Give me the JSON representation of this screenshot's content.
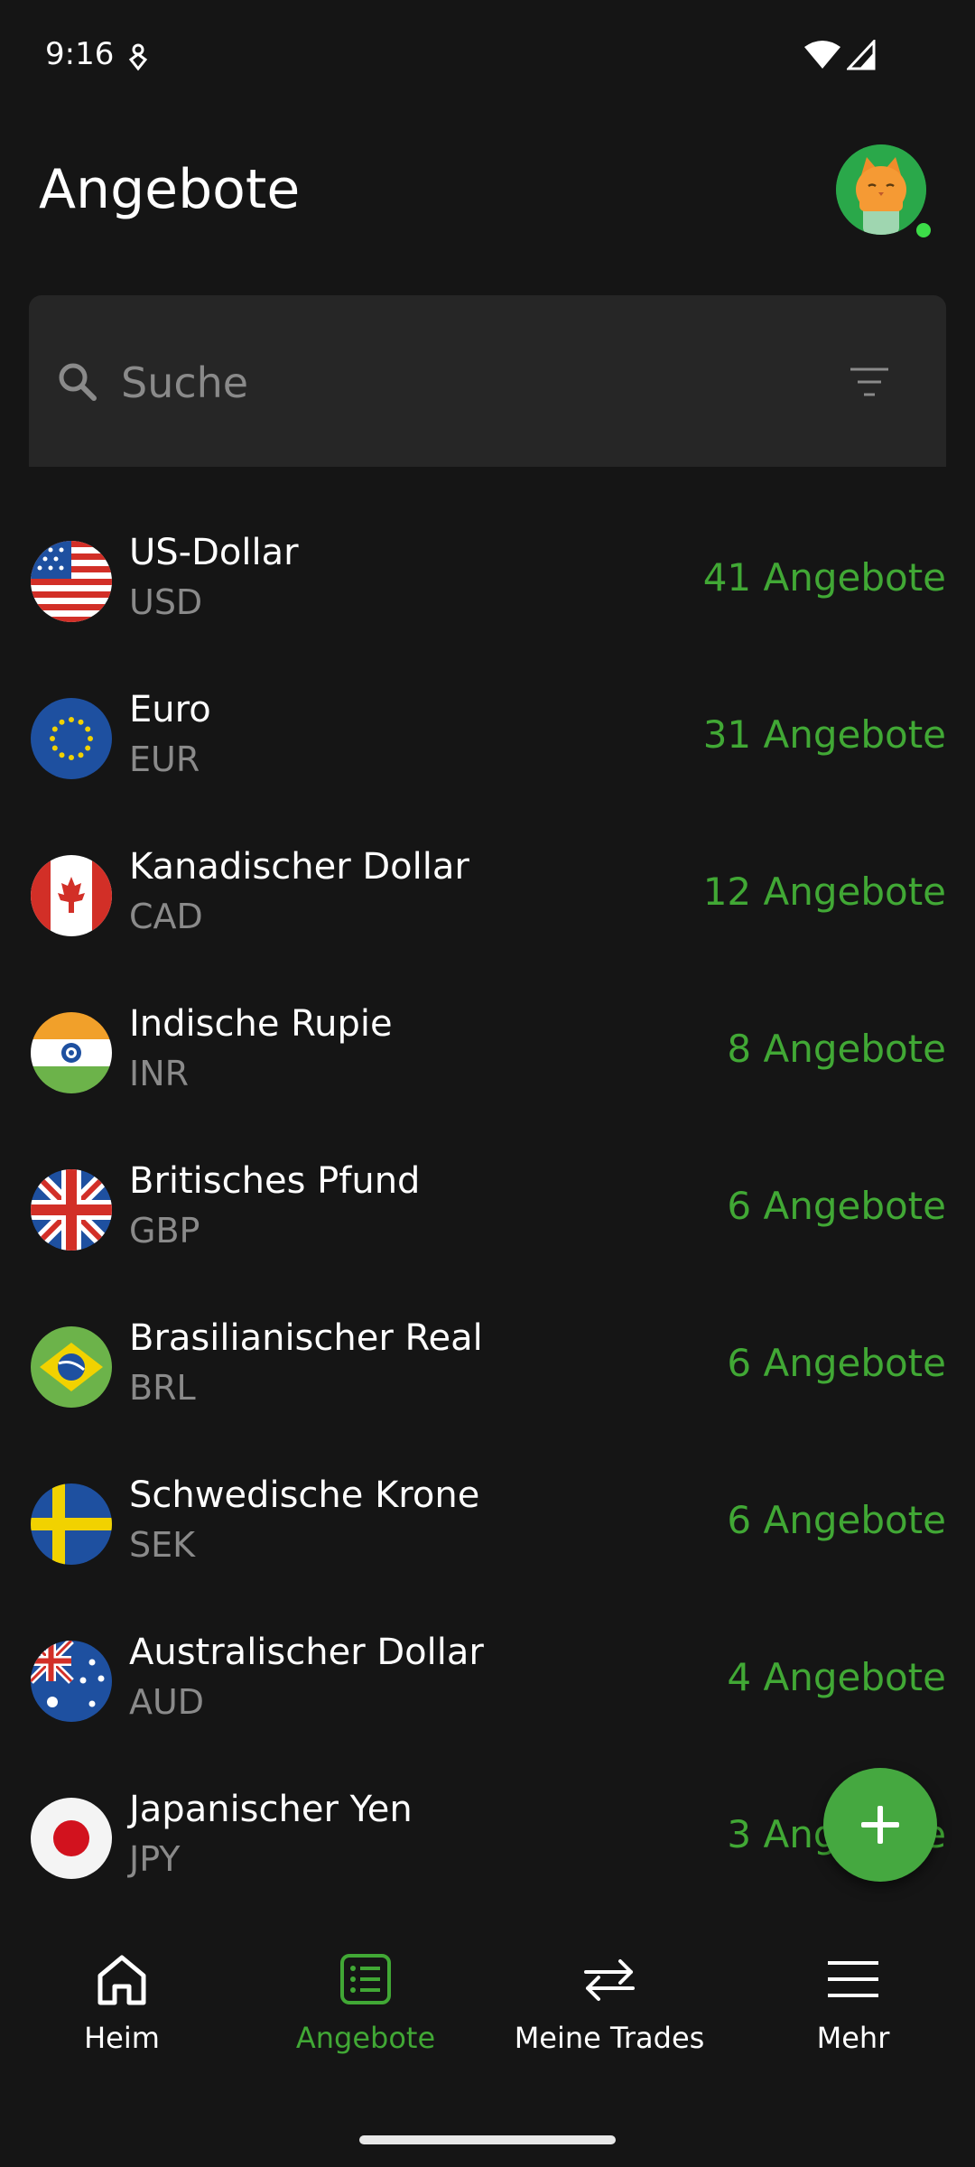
{
  "status_bar": {
    "time": "9:16"
  },
  "header": {
    "title": "Angebote"
  },
  "search": {
    "placeholder": "Suche"
  },
  "currencies": [
    {
      "name": "US-Dollar",
      "code": "USD",
      "offers": "41 Angebote",
      "flag": "us-flag-icon"
    },
    {
      "name": "Euro",
      "code": "EUR",
      "offers": "31 Angebote",
      "flag": "eu-flag-icon"
    },
    {
      "name": "Kanadischer Dollar",
      "code": "CAD",
      "offers": "12 Angebote",
      "flag": "ca-flag-icon"
    },
    {
      "name": "Indische Rupie",
      "code": "INR",
      "offers": "8 Angebote",
      "flag": "in-flag-icon"
    },
    {
      "name": "Britisches Pfund",
      "code": "GBP",
      "offers": "6 Angebote",
      "flag": "gb-flag-icon"
    },
    {
      "name": "Brasilianischer Real",
      "code": "BRL",
      "offers": "6 Angebote",
      "flag": "br-flag-icon"
    },
    {
      "name": "Schwedische Krone",
      "code": "SEK",
      "offers": "6 Angebote",
      "flag": "se-flag-icon"
    },
    {
      "name": "Australischer Dollar",
      "code": "AUD",
      "offers": "4 Angebote",
      "flag": "au-flag-icon"
    },
    {
      "name": "Japanischer Yen",
      "code": "JPY",
      "offers": "3 Angebote",
      "flag": "jp-flag-icon"
    }
  ],
  "bottom_nav": {
    "items": [
      {
        "label": "Heim",
        "icon": "home-icon",
        "active": false
      },
      {
        "label": "Angebote",
        "icon": "offers-list-icon",
        "active": true
      },
      {
        "label": "Meine Trades",
        "icon": "swap-arrows-icon",
        "active": false
      },
      {
        "label": "Mehr",
        "icon": "menu-icon",
        "active": false
      }
    ]
  },
  "colors": {
    "background": "#151515",
    "accent": "#41a835",
    "search_bg": "#262626",
    "muted_text": "#8a8a8a"
  }
}
